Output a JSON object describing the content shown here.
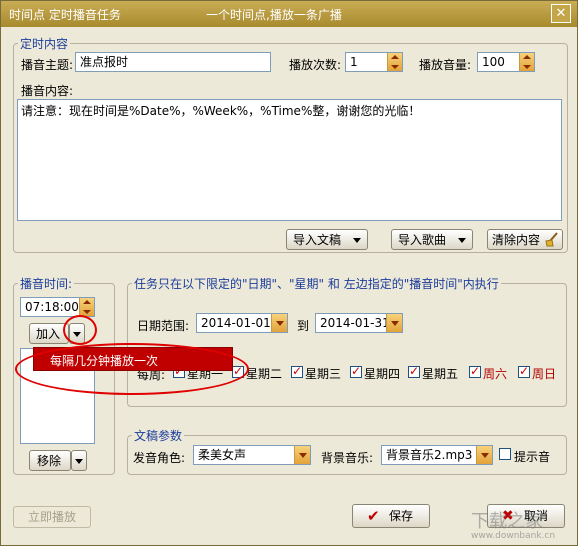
{
  "window": {
    "title_left": "时间点 定时播音任务",
    "title_center": "一个时间点,播放一条广播",
    "close_label": "✕"
  },
  "timed_content": {
    "legend": "定时内容",
    "subject_label": "播音主题:",
    "subject_value": "准点报时",
    "play_count_label": "播放次数:",
    "play_count_value": "1",
    "volume_label": "播放音量:",
    "volume_value": "100",
    "content_label": "播音内容:",
    "content_value": "请注意：现在时间是%Date%，%Week%，%Time%整，谢谢您的光临！",
    "import_text_label": "导入文稿",
    "import_song_label": "导入歌曲",
    "clear_content_label": "清除内容"
  },
  "broadcast_time": {
    "legend": "播音时间:",
    "time_value": "07:18:00",
    "add_label": "加入",
    "remove_label": "移除",
    "popup_item": "每隔几分钟播放一次"
  },
  "constraints": {
    "legend": "任务只在以下限定的\"日期\"、\"星期\" 和 左边指定的\"播音时间\"内执行",
    "date_range_label": "日期范围:",
    "date_from": "2014-01-01",
    "date_to_sep": "到",
    "date_to": "2014-01-31",
    "week_label": "每周:",
    "weekdays": [
      {
        "label": "星期一",
        "checked": true,
        "weekend": false
      },
      {
        "label": "星期二",
        "checked": true,
        "weekend": false
      },
      {
        "label": "星期三",
        "checked": true,
        "weekend": false
      },
      {
        "label": "星期四",
        "checked": true,
        "weekend": false
      },
      {
        "label": "星期五",
        "checked": true,
        "weekend": false
      },
      {
        "label": "周六",
        "checked": true,
        "weekend": true
      },
      {
        "label": "周日",
        "checked": true,
        "weekend": true
      }
    ]
  },
  "script_params": {
    "legend": "文稿参数",
    "voice_label": "发音角色:",
    "voice_value": "柔美女声",
    "bgm_label": "背景音乐:",
    "bgm_value": "背景音乐2.mp3",
    "prompt_sound_label": "提示音"
  },
  "footer": {
    "play_now_label": "立即播放",
    "save_label": "保存",
    "cancel_label": "取消"
  },
  "watermark": {
    "text": "下载之家",
    "url": "www.downbank.cn"
  },
  "colors": {
    "titlebar": "#b8993e",
    "accent_red": "#c00000",
    "legend_blue": "#1c3c9c"
  }
}
